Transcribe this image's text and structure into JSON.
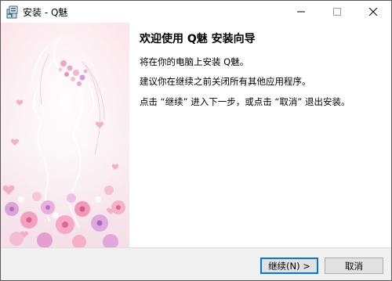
{
  "window": {
    "title": "安装 - Q魅",
    "icon": "installer-icon",
    "controls": {
      "minimize_icon": "minimize-icon",
      "maximize_icon": "maximize-icon",
      "close_icon": "close-icon"
    }
  },
  "content": {
    "heading": "欢迎使用 Q魅 安装向导",
    "paragraphs": [
      "将在你的电脑上安装 Q魅。",
      "建议你在继续之前关闭所有其他应用程序。",
      "点击 “继续” 进入下一步，或点击 “取消” 退出安装。"
    ]
  },
  "side_image": {
    "description_icon": "wizard-side-image"
  },
  "buttons": {
    "next": "继续(N) >",
    "cancel": "取消"
  },
  "colors": {
    "accent": "#0078d7",
    "bottom_bar": "#f0f0f0",
    "button_face": "#e1e1e1"
  }
}
